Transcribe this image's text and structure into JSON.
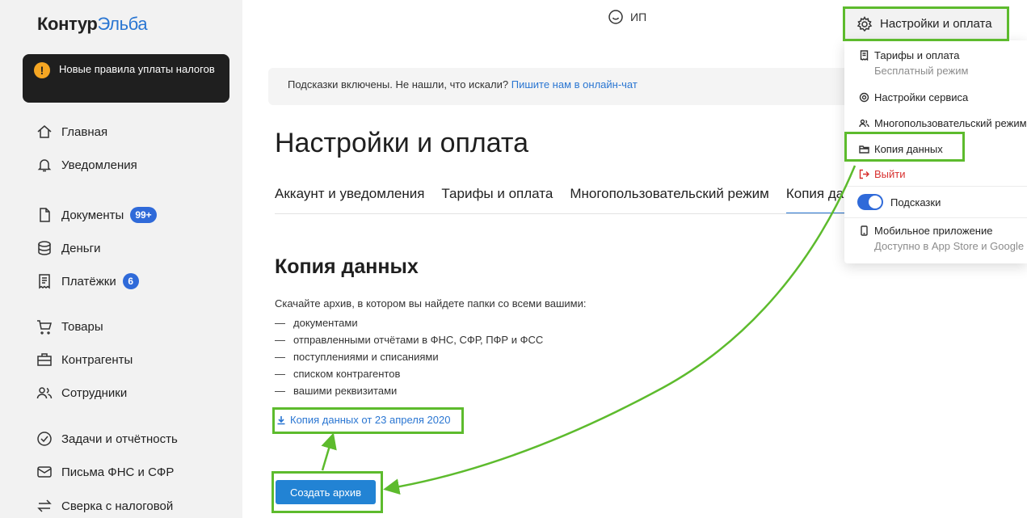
{
  "logo": {
    "part1": "Контур",
    "part2": "Эльба"
  },
  "notice": {
    "icon": "warning-icon",
    "text": "Новые правила уплаты налогов"
  },
  "nav": {
    "home": "Главная",
    "notifications": "Уведомления",
    "documents": "Документы",
    "documents_badge": "99+",
    "money": "Деньги",
    "payments": "Платёжки",
    "payments_badge": "6",
    "goods": "Товары",
    "contractors": "Контрагенты",
    "employees": "Сотрудники",
    "tasks": "Задачи и отчётность",
    "letters": "Письма ФНС и СФР",
    "reconciliation": "Сверка с налоговой"
  },
  "header": {
    "org": "ИП"
  },
  "hint": {
    "text": "Подсказки включены. Не нашли, что искали?",
    "link": "Пишите нам в онлайн-чат"
  },
  "main": {
    "title": "Настройки и оплата",
    "tabs": [
      "Аккаунт и уведомления",
      "Тарифы и оплата",
      "Многопользовательский режим",
      "Копия данных"
    ],
    "section_title": "Копия данных",
    "description": "Скачайте архив, в котором вы найдете папки со всеми вашими:",
    "list": [
      "документами",
      "отправленными отчётами в ФНС, СФР, ПФР и ФСС",
      "поступлениями и списаниями",
      "списком контрагентов",
      "вашими реквизитами"
    ],
    "download_link": "Копия данных от 23 апреля 2020",
    "create_button": "Создать архив"
  },
  "settings_button": {
    "label": "Настройки и оплата",
    "icon": "gear-icon"
  },
  "dropdown": {
    "tariffs": "Тарифы и оплата",
    "tariffs_sub": "Бесплатный режим",
    "service_settings": "Настройки сервиса",
    "multiuser": "Многопользовательский режим",
    "data_copy": "Копия данных",
    "exit": "Выйти",
    "hints": "Подсказки",
    "hints_enabled": true,
    "mobile": "Мобильное приложение",
    "mobile_sub": "Доступно в App Store и Google Play"
  },
  "colors": {
    "accent": "#2a76d2",
    "button": "#2283d4",
    "annotation": "#5dbb2d",
    "exit": "#d8302f"
  }
}
